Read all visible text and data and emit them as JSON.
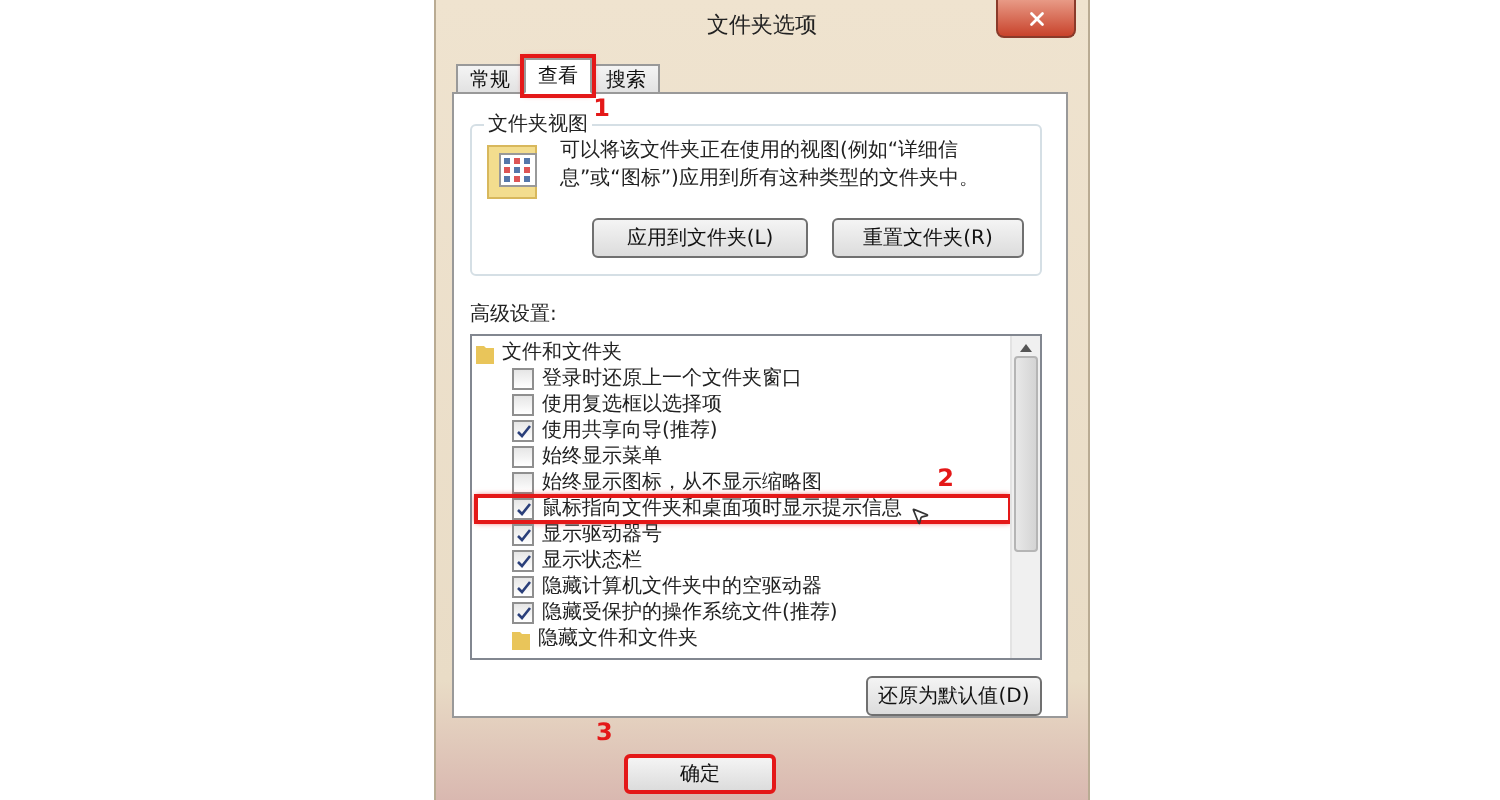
{
  "window": {
    "title": "文件夹选项"
  },
  "tabs": [
    {
      "label": "常规",
      "selected": false,
      "highlighted": false
    },
    {
      "label": "查看",
      "selected": true,
      "highlighted": true,
      "marker": "1"
    },
    {
      "label": "搜索",
      "selected": false,
      "highlighted": false
    }
  ],
  "folder_views": {
    "legend": "文件夹视图",
    "description": "可以将该文件夹正在使用的视图(例如“详细信息”或“图标”)应用到所有这种类型的文件夹中。",
    "buttons": [
      "应用到文件夹(L)",
      "重置文件夹(R)"
    ]
  },
  "advanced": {
    "label": "高级设置:",
    "items": [
      {
        "kind": "folder",
        "label": "文件和文件夹",
        "children": [
          {
            "kind": "checkbox",
            "label": "登录时还原上一个文件夹窗口",
            "checked": false,
            "highlighted": false
          },
          {
            "kind": "checkbox",
            "label": "使用复选框以选择项",
            "checked": false,
            "highlighted": false
          },
          {
            "kind": "checkbox",
            "label": "使用共享向导(推荐)",
            "checked": true,
            "highlighted": false
          },
          {
            "kind": "checkbox",
            "label": "始终显示菜单",
            "checked": false,
            "highlighted": false
          },
          {
            "kind": "checkbox",
            "label": "始终显示图标，从不显示缩略图",
            "checked": false,
            "highlighted": false
          },
          {
            "kind": "checkbox",
            "label": "鼠标指向文件夹和桌面项时显示提示信息",
            "checked": true,
            "highlighted": true,
            "marker": "2"
          },
          {
            "kind": "checkbox",
            "label": "显示驱动器号",
            "checked": true,
            "highlighted": false
          },
          {
            "kind": "checkbox",
            "label": "显示状态栏",
            "checked": true,
            "highlighted": false
          },
          {
            "kind": "checkbox",
            "label": "隐藏计算机文件夹中的空驱动器",
            "checked": true,
            "highlighted": false
          },
          {
            "kind": "checkbox",
            "label": "隐藏受保护的操作系统文件(推荐)",
            "checked": true,
            "highlighted": false
          },
          {
            "kind": "folder",
            "label": "隐藏文件和文件夹"
          }
        ]
      }
    ],
    "restore_button": "还原为默认值(D)"
  },
  "footer": {
    "buttons": [
      {
        "label": "确定",
        "highlighted": true,
        "marker": "3"
      }
    ]
  }
}
